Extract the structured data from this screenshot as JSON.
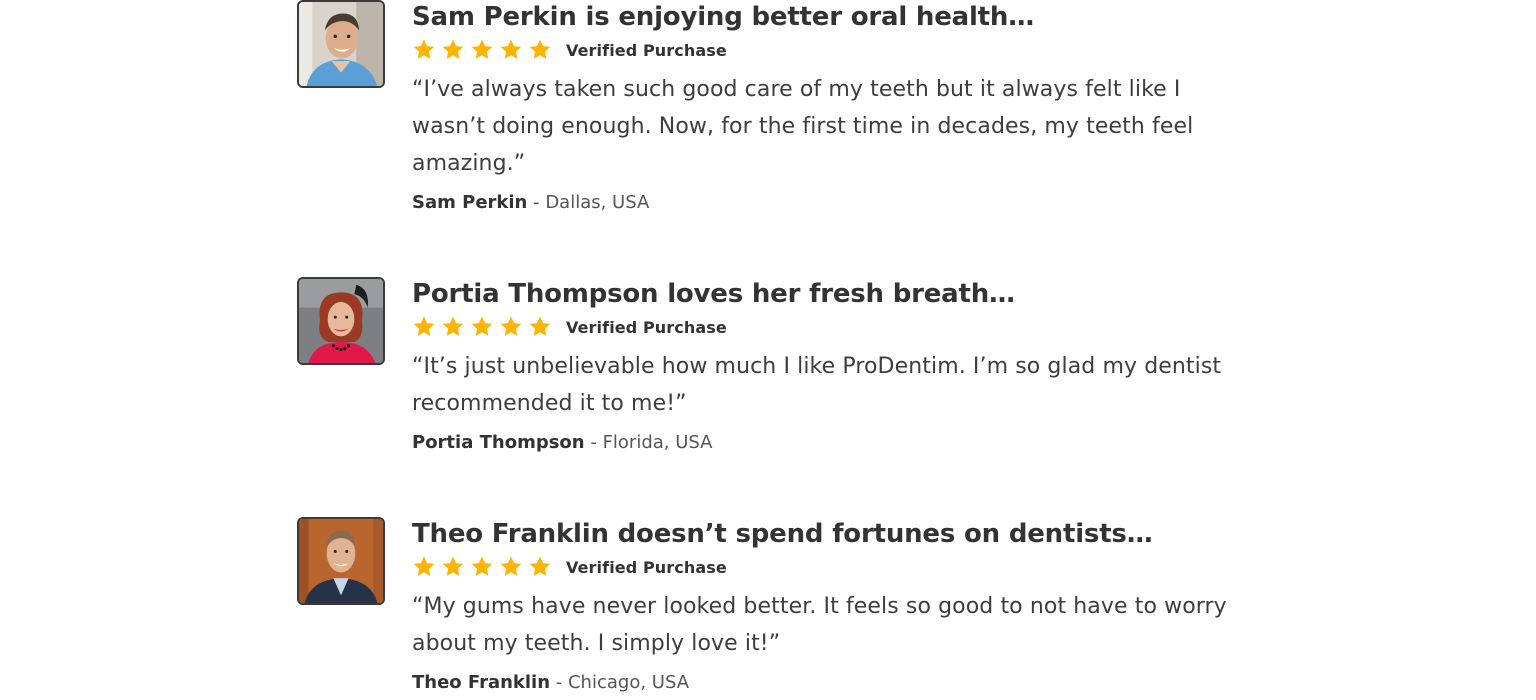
{
  "reviews": [
    {
      "headline": "Sam Perkin is enjoying better oral health…",
      "rating": 5,
      "verified_label": "Verified Purchase",
      "quote": "“I’ve always taken such good care of my teeth but it always felt like I wasn’t doing enough. Now, for the first time in decades, my teeth feel amazing.”",
      "name": "Sam Perkin",
      "location": " - Dallas, USA",
      "avatar_icon": "man-smiling-portrait"
    },
    {
      "headline": "Portia Thompson loves her fresh breath…",
      "rating": 5,
      "verified_label": "Verified Purchase",
      "quote": "“It’s just unbelievable how much I like ProDentim. I’m so glad my dentist recommended it to me!”",
      "name": "Portia Thompson",
      "location": " - Florida, USA",
      "avatar_icon": "woman-portrait"
    },
    {
      "headline": "Theo Franklin doesn’t spend fortunes on dentists…",
      "rating": 5,
      "verified_label": "Verified Purchase",
      "quote": "“My gums have never looked better. It feels so good to not have to worry about my teeth. I simply love it!”",
      "name": "Theo Franklin",
      "location": " - Chicago, USA",
      "avatar_icon": "man-suit-portrait"
    }
  ],
  "colors": {
    "star": "#FFB400",
    "text": "#333333",
    "avatar_border": "#3a3a3a"
  }
}
